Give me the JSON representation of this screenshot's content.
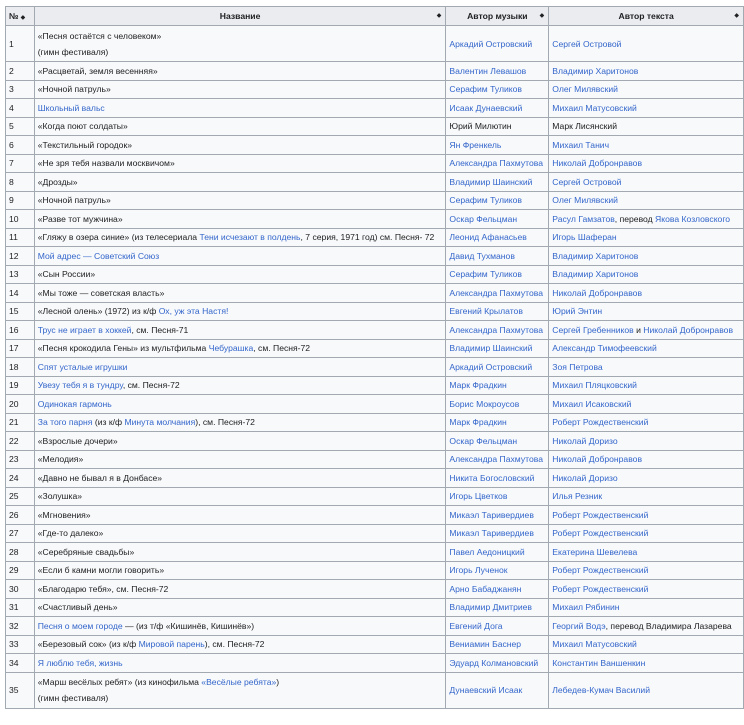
{
  "headers": {
    "num": "№",
    "title": "Название",
    "music": "Автор музыки",
    "lyrics": "Автор текста",
    "sort_icon": "sort-icon"
  },
  "rows": [
    {
      "n": "1",
      "title": [
        {
          "t": "«Песня остаётся с человеком»"
        }
      ],
      "note": "(гимн фестиваля)",
      "music": [
        {
          "t": "Аркадий Островский",
          "link": true
        }
      ],
      "lyrics": [
        {
          "t": "Сергей Островой",
          "link": true
        }
      ]
    },
    {
      "n": "2",
      "title": [
        {
          "t": "«Расцветай, земля весенняя»"
        }
      ],
      "music": [
        {
          "t": "Валентин Левашов",
          "link": true
        }
      ],
      "lyrics": [
        {
          "t": "Владимир Харитонов",
          "link": true
        }
      ]
    },
    {
      "n": "3",
      "title": [
        {
          "t": "«Ночной патруль»"
        }
      ],
      "music": [
        {
          "t": "Серафим Туликов",
          "link": true
        }
      ],
      "lyrics": [
        {
          "t": "Олег Милявский",
          "link": true
        }
      ]
    },
    {
      "n": "4",
      "title": [
        {
          "t": "Школьный вальс",
          "link": true
        }
      ],
      "music": [
        {
          "t": "Исаак Дунаевский",
          "link": true
        }
      ],
      "lyrics": [
        {
          "t": "Михаил Матусовский",
          "link": true
        }
      ]
    },
    {
      "n": "5",
      "title": [
        {
          "t": "«Когда поют солдаты»"
        }
      ],
      "music": [
        {
          "t": "Юрий Милютин"
        }
      ],
      "lyrics": [
        {
          "t": "Марк Лисянский"
        }
      ]
    },
    {
      "n": "6",
      "title": [
        {
          "t": "«Текстильный городок»"
        }
      ],
      "music": [
        {
          "t": "Ян Френкель",
          "link": true
        }
      ],
      "lyrics": [
        {
          "t": "Михаил Танич",
          "link": true
        }
      ]
    },
    {
      "n": "7",
      "title": [
        {
          "t": "«Не зря тебя назвали москвичом»"
        }
      ],
      "music": [
        {
          "t": "Александра Пахмутова",
          "link": true
        }
      ],
      "lyrics": [
        {
          "t": "Николай Добронравов",
          "link": true
        }
      ]
    },
    {
      "n": "8",
      "title": [
        {
          "t": "«Дрозды»"
        }
      ],
      "music": [
        {
          "t": "Владимир Шаинский",
          "link": true
        }
      ],
      "lyrics": [
        {
          "t": "Сергей Островой",
          "link": true
        }
      ]
    },
    {
      "n": "9",
      "title": [
        {
          "t": "«Ночной патруль»"
        }
      ],
      "music": [
        {
          "t": "Серафим Туликов",
          "link": true
        }
      ],
      "lyrics": [
        {
          "t": "Олег Милявский",
          "link": true
        }
      ]
    },
    {
      "n": "10",
      "title": [
        {
          "t": "«Разве тот мужчина»"
        }
      ],
      "music": [
        {
          "t": "Оскар Фельцман",
          "link": true
        }
      ],
      "lyrics": [
        {
          "t": "Расул Гамзатов",
          "link": true
        },
        {
          "t": ", перевод "
        },
        {
          "t": "Якова Козловского",
          "link": true
        }
      ]
    },
    {
      "n": "11",
      "title": [
        {
          "t": "«Гляжу в озера синие» (из телесериала "
        },
        {
          "t": "Тени исчезают в полдень",
          "link": true
        },
        {
          "t": ", 7 серия, 1971 год) см. "
        },
        {
          "t": "Песня- 72",
          "link": true,
          "dark": true
        }
      ],
      "music": [
        {
          "t": "Леонид Афанасьев",
          "link": true
        }
      ],
      "lyrics": [
        {
          "t": "Игорь Шаферан",
          "link": true
        }
      ]
    },
    {
      "n": "12",
      "title": [
        {
          "t": "Мой адрес — Советский Союз",
          "link": true
        }
      ],
      "music": [
        {
          "t": "Давид Тухманов",
          "link": true
        }
      ],
      "lyrics": [
        {
          "t": "Владимир Харитонов",
          "link": true
        }
      ]
    },
    {
      "n": "13",
      "title": [
        {
          "t": "«Сын России»"
        }
      ],
      "music": [
        {
          "t": "Серафим Туликов",
          "link": true
        }
      ],
      "lyrics": [
        {
          "t": "Владимир Харитонов",
          "link": true
        }
      ]
    },
    {
      "n": "14",
      "title": [
        {
          "t": "«Мы тоже — советская власть»"
        }
      ],
      "music": [
        {
          "t": "Александра Пахмутова",
          "link": true
        }
      ],
      "lyrics": [
        {
          "t": "Николай Добронравов",
          "link": true
        }
      ]
    },
    {
      "n": "15",
      "title": [
        {
          "t": "«Лесной олень» (1972) из к/ф "
        },
        {
          "t": "Ох, уж эта Настя!",
          "link": true
        }
      ],
      "music": [
        {
          "t": "Евгений Крылатов",
          "link": true
        }
      ],
      "lyrics": [
        {
          "t": "Юрий Энтин",
          "link": true
        }
      ]
    },
    {
      "n": "16",
      "title": [
        {
          "t": "Трус не играет в хоккей",
          "link": true
        },
        {
          "t": ", см. "
        },
        {
          "t": "Песня-71",
          "link": true,
          "dark": true
        }
      ],
      "music": [
        {
          "t": "Александра Пахмутова",
          "link": true
        }
      ],
      "lyrics": [
        {
          "t": "Сергей Гребенников",
          "link": true
        },
        {
          "t": " и "
        },
        {
          "t": "Николай Добронравов",
          "link": true
        }
      ]
    },
    {
      "n": "17",
      "title": [
        {
          "t": "«Песня крокодила Гены» из мультфильма "
        },
        {
          "t": "Чебурашка",
          "link": true
        },
        {
          "t": ", см. "
        },
        {
          "t": "Песня-72",
          "link": true,
          "dark": true
        }
      ],
      "music": [
        {
          "t": "Владимир Шаинский",
          "link": true
        }
      ],
      "lyrics": [
        {
          "t": "Александр Тимофеевский",
          "link": true
        }
      ]
    },
    {
      "n": "18",
      "title": [
        {
          "t": "Спят усталые игрушки",
          "link": true
        }
      ],
      "music": [
        {
          "t": "Аркадий Островский",
          "link": true
        }
      ],
      "lyrics": [
        {
          "t": "Зоя Петрова",
          "link": true
        }
      ]
    },
    {
      "n": "19",
      "title": [
        {
          "t": "Увезу тебя я в тундру",
          "link": true
        },
        {
          "t": ", см. "
        },
        {
          "t": "Песня-72",
          "link": true,
          "dark": true
        }
      ],
      "music": [
        {
          "t": "Марк Фрадкин",
          "link": true
        }
      ],
      "lyrics": [
        {
          "t": "Михаил Пляцковский",
          "link": true
        }
      ]
    },
    {
      "n": "20",
      "title": [
        {
          "t": "Одинокая гармонь",
          "link": true
        }
      ],
      "music": [
        {
          "t": "Борис Мокроусов",
          "link": true
        }
      ],
      "lyrics": [
        {
          "t": "Михаил Исаковский",
          "link": true
        }
      ]
    },
    {
      "n": "21",
      "title": [
        {
          "t": "За того парня",
          "link": true
        },
        {
          "t": " (из к/ф "
        },
        {
          "t": "Минута молчания",
          "link": true
        },
        {
          "t": "), см. "
        },
        {
          "t": "Песня-72",
          "link": true,
          "dark": true
        }
      ],
      "music": [
        {
          "t": "Марк Фрадкин",
          "link": true
        }
      ],
      "lyrics": [
        {
          "t": "Роберт Рождественский",
          "link": true
        }
      ]
    },
    {
      "n": "22",
      "title": [
        {
          "t": "«Взрослые дочери»"
        }
      ],
      "music": [
        {
          "t": "Оскар Фельцман",
          "link": true
        }
      ],
      "lyrics": [
        {
          "t": "Николай Доризо",
          "link": true
        }
      ]
    },
    {
      "n": "23",
      "title": [
        {
          "t": "«Мелодия»"
        }
      ],
      "music": [
        {
          "t": "Александра Пахмутова",
          "link": true
        }
      ],
      "lyrics": [
        {
          "t": "Николай Добронравов",
          "link": true
        }
      ]
    },
    {
      "n": "24",
      "title": [
        {
          "t": "«Давно не бывал я в Донбасе»"
        }
      ],
      "music": [
        {
          "t": "Никита Богословский",
          "link": true
        }
      ],
      "lyrics": [
        {
          "t": "Николай Доризо",
          "link": true
        }
      ]
    },
    {
      "n": "25",
      "title": [
        {
          "t": "«Золушка»"
        }
      ],
      "music": [
        {
          "t": "Игорь Цветков",
          "link": true
        }
      ],
      "lyrics": [
        {
          "t": "Илья Резник",
          "link": true
        }
      ]
    },
    {
      "n": "26",
      "title": [
        {
          "t": "«Мгновения»"
        }
      ],
      "music": [
        {
          "t": "Микаэл Таривердиев",
          "link": true
        }
      ],
      "lyrics": [
        {
          "t": "Роберт Рождественский",
          "link": true
        }
      ]
    },
    {
      "n": "27",
      "title": [
        {
          "t": "«Где-то далеко»"
        }
      ],
      "music": [
        {
          "t": "Микаэл Таривердиев",
          "link": true
        }
      ],
      "lyrics": [
        {
          "t": "Роберт Рождественский",
          "link": true
        }
      ]
    },
    {
      "n": "28",
      "title": [
        {
          "t": "«Серебряные свадьбы»"
        }
      ],
      "music": [
        {
          "t": "Павел Аедоницкий",
          "link": true
        }
      ],
      "lyrics": [
        {
          "t": "Екатерина Шевелева",
          "link": true
        }
      ]
    },
    {
      "n": "29",
      "title": [
        {
          "t": "«Если б камни могли говорить»"
        }
      ],
      "music": [
        {
          "t": "Игорь Лученок",
          "link": true
        }
      ],
      "lyrics": [
        {
          "t": "Роберт Рождественский",
          "link": true
        }
      ]
    },
    {
      "n": "30",
      "title": [
        {
          "t": "«Благодарю тебя», см. "
        },
        {
          "t": "Песня-72",
          "link": true,
          "dark": true
        }
      ],
      "music": [
        {
          "t": "Арно Бабаджанян",
          "link": true
        }
      ],
      "lyrics": [
        {
          "t": "Роберт Рождественский",
          "link": true
        }
      ]
    },
    {
      "n": "31",
      "title": [
        {
          "t": "«Счастливый день»"
        }
      ],
      "music": [
        {
          "t": "Владимир Дмитриев",
          "link": true
        }
      ],
      "lyrics": [
        {
          "t": "Михаил Рябинин",
          "link": true
        }
      ]
    },
    {
      "n": "32",
      "title": [
        {
          "t": "Песня о моем городе",
          "link": true
        },
        {
          "t": " — (из т/ф «Кишинёв, Кишинёв»)"
        }
      ],
      "music": [
        {
          "t": "Евгений Дога",
          "link": true
        }
      ],
      "lyrics": [
        {
          "t": "Георгий Водэ",
          "link": true
        },
        {
          "t": ", перевод Владимира Лазарева"
        }
      ]
    },
    {
      "n": "33",
      "title": [
        {
          "t": "«Березовый сок» (из к/ф "
        },
        {
          "t": "Мировой парень",
          "link": true
        },
        {
          "t": "), см. "
        },
        {
          "t": "Песня-72",
          "link": true,
          "dark": true
        }
      ],
      "music": [
        {
          "t": "Вениамин Баснер",
          "link": true
        }
      ],
      "lyrics": [
        {
          "t": "Михаил Матусовский",
          "link": true
        }
      ]
    },
    {
      "n": "34",
      "title": [
        {
          "t": "Я люблю тебя, жизнь",
          "link": true
        }
      ],
      "music": [
        {
          "t": "Эдуард Колмановский",
          "link": true
        }
      ],
      "lyrics": [
        {
          "t": "Константин Ваншенкин",
          "link": true
        }
      ]
    },
    {
      "n": "35",
      "title": [
        {
          "t": "«Марш весёлых ребят» (из кинофильма "
        },
        {
          "t": "«Весёлые ребята»",
          "link": true
        },
        {
          "t": ")"
        }
      ],
      "note": "(гимн фестиваля)",
      "music": [
        {
          "t": "Дунаевский Исаак",
          "link": true
        }
      ],
      "lyrics": [
        {
          "t": "Лебедев-Кумач Василий",
          "link": true
        }
      ]
    }
  ]
}
